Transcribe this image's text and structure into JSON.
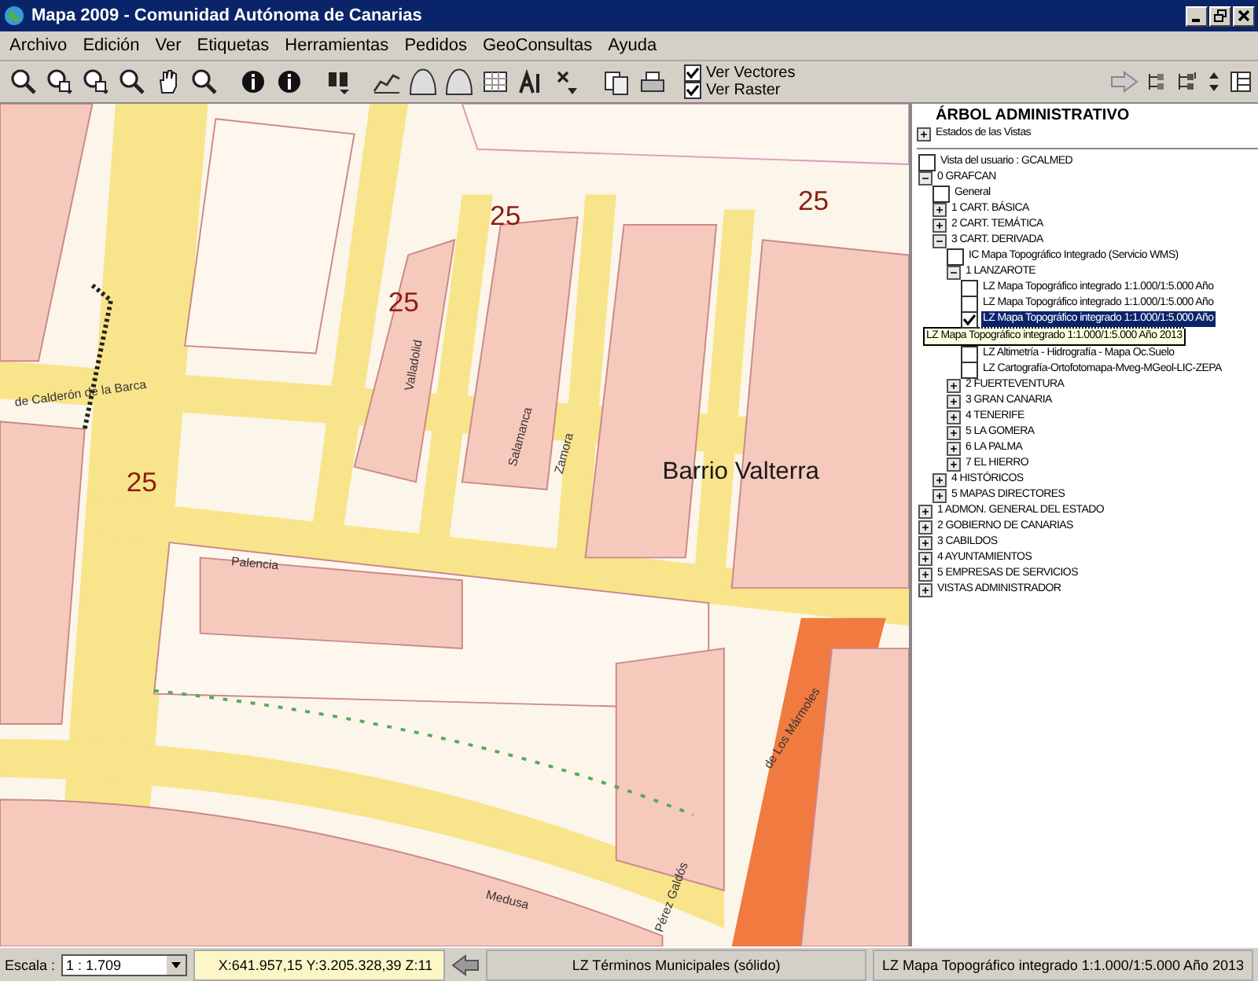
{
  "window": {
    "title": "Mapa  2009 - Comunidad Autónoma de Canarias"
  },
  "menu": [
    "Archivo",
    "Edición",
    "Ver",
    "Etiquetas",
    "Herramientas",
    "Pedidos",
    "GeoConsultas",
    "Ayuda"
  ],
  "toolbar": {
    "checkboxes": [
      {
        "label": "Ver Vectores",
        "checked": true
      },
      {
        "label": "Ver Raster",
        "checked": true
      }
    ]
  },
  "map": {
    "labels": [
      {
        "text": "Barrio Valterra",
        "kind": "district"
      },
      {
        "text": "25",
        "kind": "contour"
      },
      {
        "text": "25",
        "kind": "contour"
      },
      {
        "text": "25",
        "kind": "contour"
      },
      {
        "text": "25",
        "kind": "contour"
      },
      {
        "text": "Palencia",
        "kind": "street"
      },
      {
        "text": "Salamanca",
        "kind": "street"
      },
      {
        "text": "Zamora",
        "kind": "street"
      },
      {
        "text": "Valladolid",
        "kind": "street"
      },
      {
        "text": "de Calderón de la Barca",
        "kind": "street"
      },
      {
        "text": "de Los Mármoles",
        "kind": "street"
      },
      {
        "text": "Pérez Galdós",
        "kind": "street"
      },
      {
        "text": "Medusa",
        "kind": "street"
      }
    ]
  },
  "tree": {
    "title": "ÁRBOL ADMINISTRATIVO",
    "header_item": {
      "label": "Estados de las Vistas",
      "expanded": false
    },
    "items": [
      {
        "label": "Vista del usuario : GCALMED",
        "kind": "layer",
        "checked": false,
        "selected": false
      },
      {
        "label": "0 GRAFCAN",
        "kind": "folder",
        "expanded": true,
        "children": [
          {
            "label": "General",
            "kind": "layer",
            "checked": false,
            "selected": false
          },
          {
            "label": "1 CART. BÁSICA",
            "kind": "folder",
            "expanded": false
          },
          {
            "label": "2 CART. TEMÁTICA",
            "kind": "folder",
            "expanded": false
          },
          {
            "label": "3 CART. DERIVADA",
            "kind": "folder",
            "expanded": true,
            "children": [
              {
                "label": "IC Mapa Topográfico Integrado (Servicio WMS)",
                "kind": "layer",
                "checked": false,
                "selected": false
              },
              {
                "label": "1 LANZAROTE",
                "kind": "folder",
                "expanded": true,
                "children": [
                  {
                    "label": "LZ Mapa Topográfico integrado 1:1.000/1:5.000 Año",
                    "kind": "layer",
                    "checked": false,
                    "selected": false
                  },
                  {
                    "label": "LZ Mapa Topográfico integrado 1:1.000/1:5.000 Año",
                    "kind": "layer",
                    "checked": false,
                    "selected": false
                  },
                  {
                    "label": "LZ Mapa Topográfico integrado 1:1.000/1:5.000 Año",
                    "kind": "layer",
                    "checked": true,
                    "selected": true
                  },
                  {
                    "label": "LZ Mapa Topográfico integrado 1:1.000/1:5.000 Año 2013",
                    "kind": "tooltip"
                  },
                  {
                    "label": "LZ Altimetría - Hidrografía - Mapa Oc.Suelo",
                    "kind": "layer",
                    "checked": false,
                    "selected": false
                  },
                  {
                    "label": "LZ Cartografía-Ortofotomapa-Mveg-MGeol-LIC-ZEPA",
                    "kind": "layer",
                    "checked": false,
                    "selected": false
                  }
                ]
              },
              {
                "label": "2 FUERTEVENTURA",
                "kind": "folder",
                "expanded": false
              },
              {
                "label": "3 GRAN CANARIA",
                "kind": "folder",
                "expanded": false
              },
              {
                "label": "4 TENERIFE",
                "kind": "folder",
                "expanded": false
              },
              {
                "label": "5 LA GOMERA",
                "kind": "folder",
                "expanded": false
              },
              {
                "label": "6 LA PALMA",
                "kind": "folder",
                "expanded": false
              },
              {
                "label": "7 EL HIERRO",
                "kind": "folder",
                "expanded": false
              }
            ]
          },
          {
            "label": "4 HISTÓRICOS",
            "kind": "folder",
            "expanded": false
          },
          {
            "label": "5 MAPAS DIRECTORES",
            "kind": "folder",
            "expanded": false
          }
        ]
      },
      {
        "label": "1 ADMON. GENERAL DEL ESTADO",
        "kind": "folder",
        "expanded": false
      },
      {
        "label": "2 GOBIERNO DE CANARIAS",
        "kind": "folder",
        "expanded": false
      },
      {
        "label": "3 CABILDOS",
        "kind": "folder",
        "expanded": false
      },
      {
        "label": "4 AYUNTAMIENTOS",
        "kind": "folder",
        "expanded": false
      },
      {
        "label": "5 EMPRESAS DE SERVICIOS",
        "kind": "folder",
        "expanded": false
      },
      {
        "label": "VISTAS ADMINISTRADOR",
        "kind": "folder",
        "expanded": false
      }
    ]
  },
  "status_bar": {
    "scale_label": "Escala :",
    "scale_value": "1 : 1.709",
    "coordinates": "X:641.957,15  Y:3.205.328,39  Z:11",
    "layer_vector": "LZ Términos Municipales (sólido)",
    "layer_raster": "LZ Mapa Topográfico integrado 1:1.000/1:5.000 Año 2013"
  }
}
